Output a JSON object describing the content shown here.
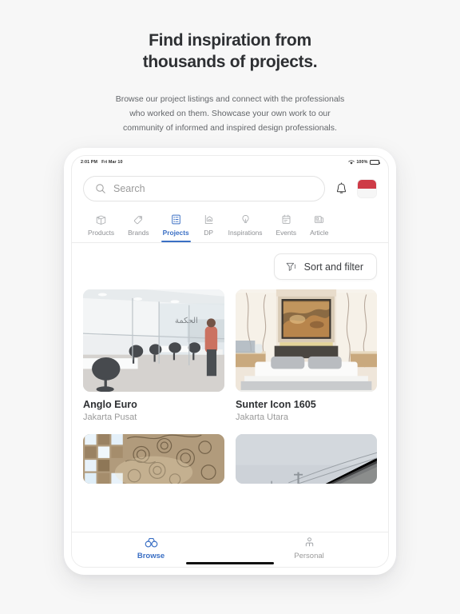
{
  "hero": {
    "title_line1": "Find inspiration from",
    "title_line2": "thousands of projects.",
    "subtitle_line1": "Browse our project listings and connect with the professionals",
    "subtitle_line2": "who worked on them. Showcase your own work to our",
    "subtitle_line3": "community of informed and inspired design professionals."
  },
  "statusbar": {
    "time": "2:01 PM",
    "date": "Fri Mar 10",
    "battery_percent": "100%",
    "wifi_icon": "wifi-icon",
    "battery_icon": "battery-full-icon"
  },
  "search": {
    "placeholder": "Search",
    "value": "",
    "search_icon": "search-icon",
    "bell_icon": "bell-icon",
    "avatar_icon": "avatar-flag-indonesia"
  },
  "tabs": [
    {
      "label": "Products",
      "icon": "box-icon",
      "active": false
    },
    {
      "label": "Brands",
      "icon": "tag-icon",
      "active": false
    },
    {
      "label": "Projects",
      "icon": "list-grid-icon",
      "active": true
    },
    {
      "label": "DP",
      "icon": "house-plan-icon",
      "active": false
    },
    {
      "label": "Inspirations",
      "icon": "lightbulb-icon",
      "active": false
    },
    {
      "label": "Events",
      "icon": "calendar-icon",
      "active": false
    },
    {
      "label": "Article",
      "icon": "newspaper-icon",
      "active": false
    }
  ],
  "toolbar": {
    "sort_filter_label": "Sort and filter",
    "sort_filter_icon": "filter-sort-icon"
  },
  "projects": [
    {
      "title": "Anglo Euro",
      "location": "Jakarta Pusat",
      "image": "office-glass-partition-workstations"
    },
    {
      "title": "Sunter Icon 1605",
      "location": "Jakarta Utara",
      "image": "luxury-bedroom-marble-wall-artwork"
    },
    {
      "title": "",
      "location": "",
      "image": "patterned-wall-glowing-tiles"
    },
    {
      "title": "",
      "location": "",
      "image": "gray-sky-rooftop-powerlines"
    }
  ],
  "bottom_nav": [
    {
      "label": "Browse",
      "icon": "binoculars-icon",
      "active": true
    },
    {
      "label": "Personal",
      "icon": "person-icon",
      "active": false
    }
  ],
  "colors": {
    "accent_blue": "#3a6fc4",
    "avatar_red": "#ce3b47",
    "page_background": "#f7f7f7",
    "text_primary": "#2e3033",
    "text_muted": "#9a9a9a"
  }
}
